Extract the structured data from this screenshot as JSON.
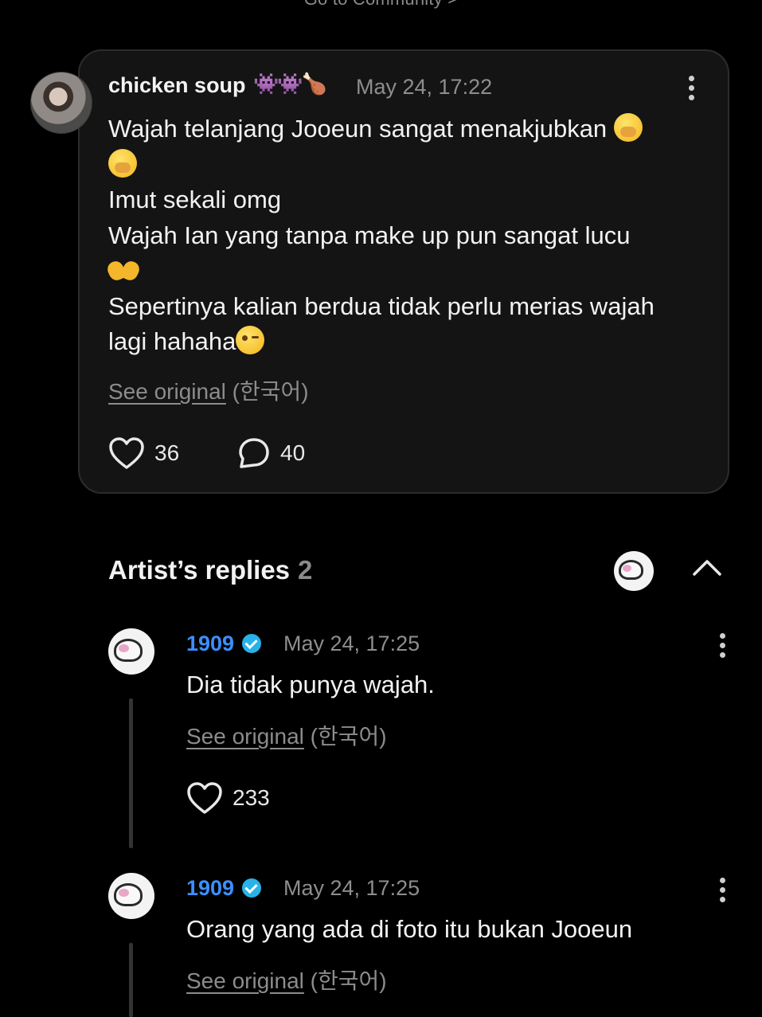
{
  "top_link": "Go to Community >",
  "post": {
    "author": "chicken soup",
    "author_emoji": "👾👾🍗",
    "time": "May 24, 17:22",
    "lines": [
      "Wajah telanjang Jooeun sangat menakjubkan",
      "Imut sekali omg",
      "Wajah Ian yang tanpa make up pun sangat lucu",
      "Sepertinya kalian berdua tidak perlu merias wajah",
      "lagi hahaha"
    ],
    "see_original": "See original",
    "language": "(한국어)",
    "likes": "36",
    "comments": "40"
  },
  "replies_section": {
    "title": "Artist’s replies",
    "count": "2"
  },
  "replies": [
    {
      "author": "1909",
      "time": "May 24, 17:25",
      "text": "Dia tidak punya wajah.",
      "see_original": "See original",
      "language": "(한국어)",
      "likes": "233"
    },
    {
      "author": "1909",
      "time": "May 24, 17:25",
      "text": "Orang yang ada di foto itu bukan Jooeun",
      "see_original": "See original",
      "language": "(한국어)"
    }
  ],
  "icons": {
    "like": "heart-icon",
    "comment": "speech-bubble-icon",
    "more": "kebab-menu-icon",
    "collapse": "chevron-up-icon",
    "verified": "verified-badge-icon"
  }
}
